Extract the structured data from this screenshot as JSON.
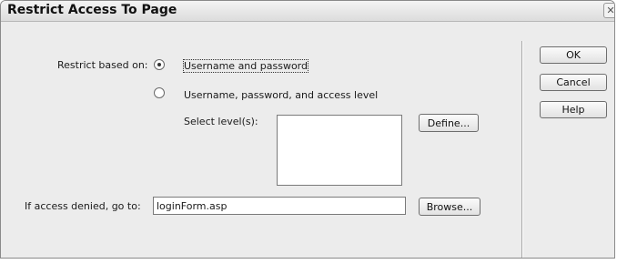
{
  "dialog": {
    "title": "Restrict Access To Page",
    "close_glyph": "✕"
  },
  "restrict": {
    "label": "Restrict based on:",
    "options": [
      {
        "label": "Username and password",
        "selected": true
      },
      {
        "label": "Username, password, and access level",
        "selected": false
      }
    ],
    "levels_label": "Select level(s):",
    "define_label": "Define..."
  },
  "denied": {
    "label": "If access denied, go to:",
    "value": "loginForm.asp",
    "browse_label": "Browse..."
  },
  "buttons": {
    "ok": "OK",
    "cancel": "Cancel",
    "help": "Help"
  }
}
